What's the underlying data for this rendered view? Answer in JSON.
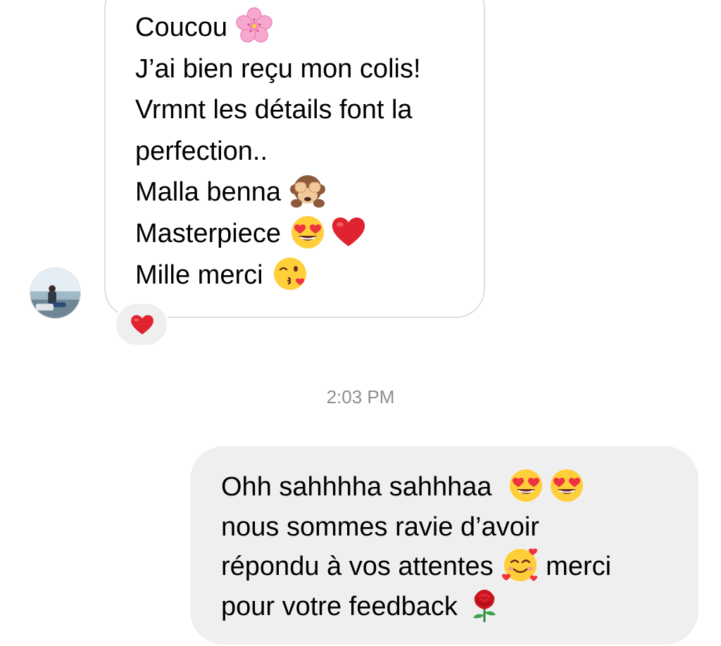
{
  "conversation": {
    "incoming": {
      "lines": [
        {
          "text": "Coucou",
          "emoji": [
            "cherry-blossom-emoji"
          ]
        },
        {
          "text": "J’ai bien reçu mon colis!",
          "emoji": []
        },
        {
          "text": "Vrmnt les détails font la",
          "emoji": []
        },
        {
          "text": "perfection..",
          "emoji": []
        },
        {
          "text": "Malla benna",
          "emoji": [
            "see-no-evil-monkey-emoji"
          ]
        },
        {
          "text": "Masterpiece",
          "emoji": [
            "heart-eyes-emoji",
            "red-heart-emoji"
          ]
        },
        {
          "text": "Mille merci",
          "emoji": [
            "kissing-face-emoji"
          ]
        }
      ],
      "reaction": "red-heart-emoji",
      "sender_avatar": "avatar"
    },
    "timestamp": "2:03 PM",
    "outgoing": {
      "lines": [
        {
          "text": "Ohh sahhhha sahhhaa ",
          "emoji": [
            "heart-eyes-emoji",
            "heart-eyes-emoji"
          ]
        },
        {
          "text": "nous sommes ravie d’avoir",
          "emoji": []
        },
        {
          "text": "répondu à vos attentes",
          "emoji": [
            "smiling-face-with-hearts-emoji"
          ],
          "after": "merci"
        },
        {
          "text": "pour votre feedback",
          "emoji": [
            "rose-emoji"
          ]
        }
      ]
    }
  },
  "colors": {
    "incoming_border": "#dedede",
    "outgoing_bg": "#efefef",
    "timestamp": "#8e8e8e",
    "reaction_heart": "#e0242f"
  }
}
